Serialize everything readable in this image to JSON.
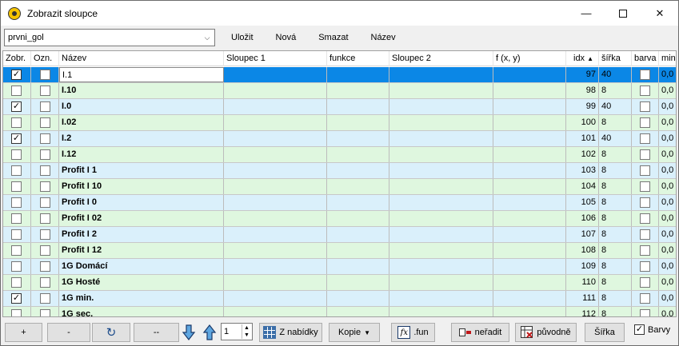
{
  "window": {
    "title": "Zobrazit sloupce"
  },
  "toolbar": {
    "combo_value": "prvni_gol",
    "save_label": "Uložit",
    "new_label": "Nová",
    "delete_label": "Smazat",
    "name_label": "Název"
  },
  "headers": {
    "zobr": "Zobr.",
    "ozn": "Ozn.",
    "nazev": "Název",
    "sloupec1": "Sloupec 1",
    "funkce": "funkce",
    "sloupec2": "Sloupec 2",
    "fxy": "f (x, y)",
    "idx": "idx",
    "sirka": "šířka",
    "barva": "barva",
    "min": "min"
  },
  "rows": [
    {
      "zobr": true,
      "name": "I.1",
      "idx": "97",
      "width": "40",
      "min": "0,0"
    },
    {
      "zobr": false,
      "name": "I.10",
      "idx": "98",
      "width": "8",
      "min": "0,0"
    },
    {
      "zobr": true,
      "name": "I.0",
      "idx": "99",
      "width": "40",
      "min": "0,0"
    },
    {
      "zobr": false,
      "name": "I.02",
      "idx": "100",
      "width": "8",
      "min": "0,0"
    },
    {
      "zobr": true,
      "name": "I.2",
      "idx": "101",
      "width": "40",
      "min": "0,0"
    },
    {
      "zobr": false,
      "name": "I.12",
      "idx": "102",
      "width": "8",
      "min": "0,0"
    },
    {
      "zobr": false,
      "name": "Profit I 1",
      "idx": "103",
      "width": "8",
      "min": "0,0"
    },
    {
      "zobr": false,
      "name": "Profit I 10",
      "idx": "104",
      "width": "8",
      "min": "0,0"
    },
    {
      "zobr": false,
      "name": "Profit I 0",
      "idx": "105",
      "width": "8",
      "min": "0,0"
    },
    {
      "zobr": false,
      "name": "Profit I 02",
      "idx": "106",
      "width": "8",
      "min": "0,0"
    },
    {
      "zobr": false,
      "name": "Profit I 2",
      "idx": "107",
      "width": "8",
      "min": "0,0"
    },
    {
      "zobr": false,
      "name": "Profit I 12",
      "idx": "108",
      "width": "8",
      "min": "0,0"
    },
    {
      "zobr": false,
      "name": "1G Domácí",
      "idx": "109",
      "width": "8",
      "min": "0,0"
    },
    {
      "zobr": false,
      "name": "1G Hosté",
      "idx": "110",
      "width": "8",
      "min": "0,0"
    },
    {
      "zobr": true,
      "name": "1G min.",
      "idx": "111",
      "width": "8",
      "min": "0,0"
    },
    {
      "zobr": false,
      "name": "1G sec.",
      "idx": "112",
      "width": "8",
      "min": "0,0"
    }
  ],
  "bottom": {
    "plus": "+",
    "minus": "-",
    "dashes": "--",
    "spin_value": "1",
    "z_nabidky": "Z nabídky",
    "kopie": "Kopie",
    "fun": ".fun",
    "neradit": "neřadit",
    "puvodne": "původně",
    "sirka": "Šířka",
    "barvy": "Barvy"
  },
  "colors": {
    "selected": "#0b87e6",
    "row_blue": "#daf0fb",
    "row_green": "#dff7df"
  }
}
